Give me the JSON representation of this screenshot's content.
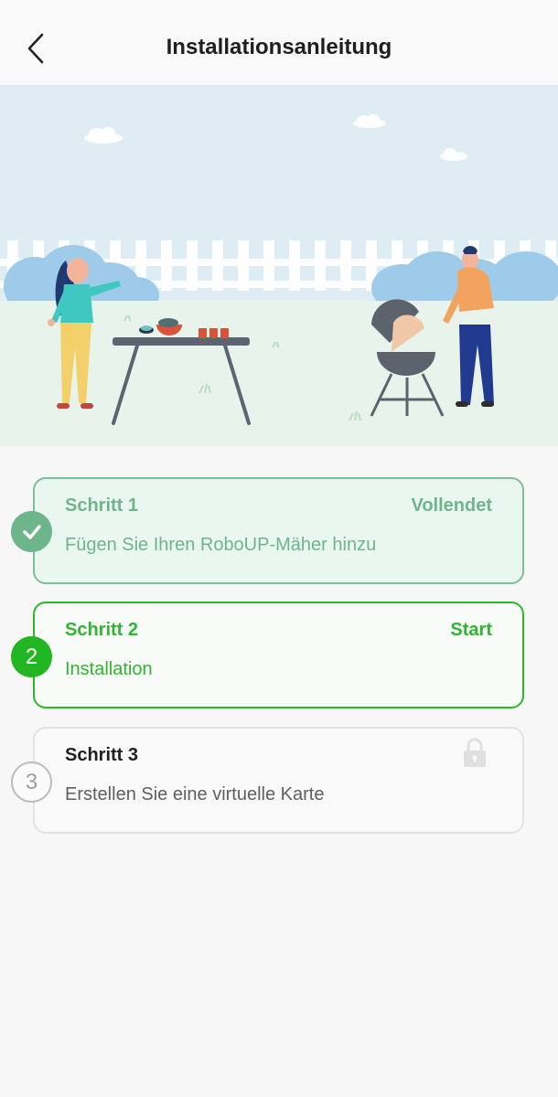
{
  "header": {
    "title": "Installationsanleitung",
    "back_icon": "chevron-left-icon"
  },
  "hero": {
    "illustration": "barbecue-garden-illustration"
  },
  "steps": [
    {
      "title": "Schritt 1",
      "status": "Vollendet",
      "description": "Fügen Sie Ihren RoboUP-Mäher hinzu",
      "badge_icon": "checkmark-icon",
      "state": "completed",
      "color": "#6db58a"
    },
    {
      "title": "Schritt 2",
      "status": "Start",
      "description": "Installation",
      "badge_number": "2",
      "state": "active",
      "color": "#22b622"
    },
    {
      "title": "Schritt 3",
      "description": "Erstellen Sie eine virtuelle Karte",
      "badge_number": "3",
      "status_icon": "lock-icon",
      "state": "locked",
      "color": "#bdbdbd"
    }
  ]
}
